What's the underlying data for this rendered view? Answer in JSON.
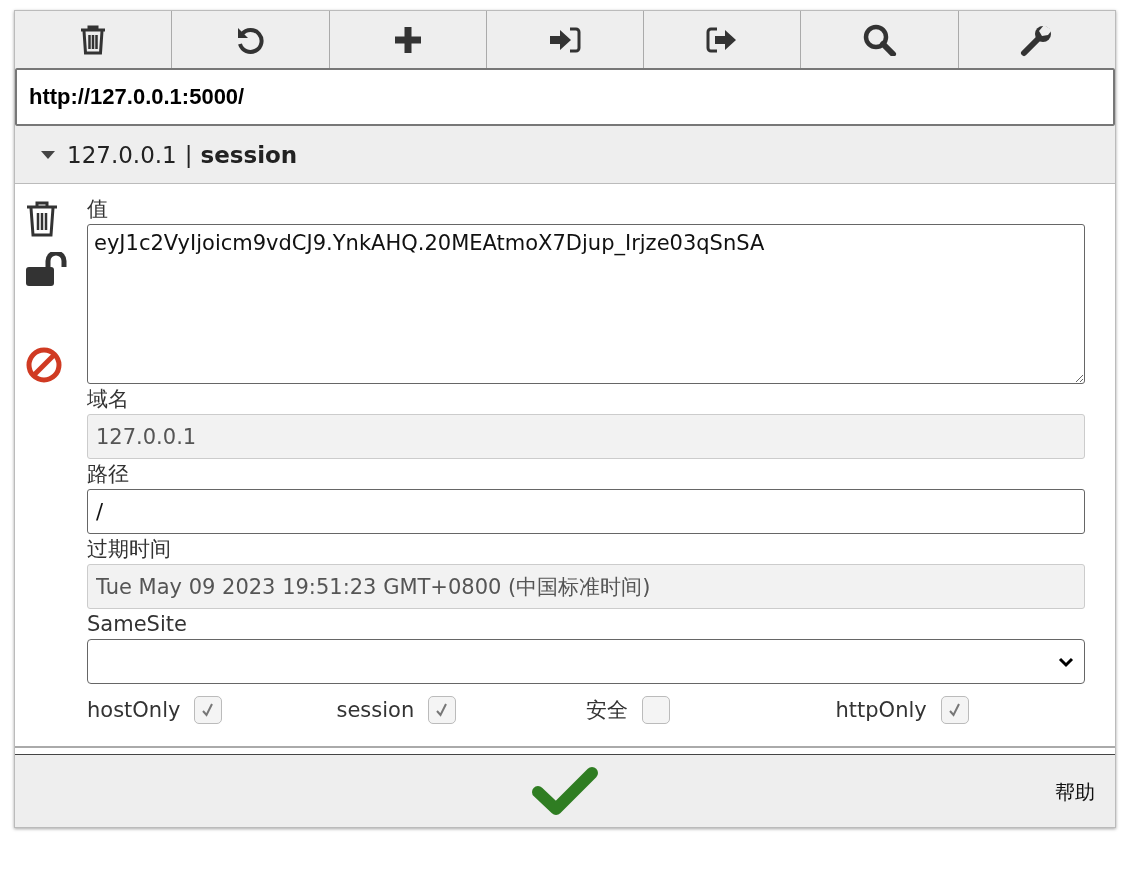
{
  "toolbar": {
    "buttons": [
      {
        "kind": "delete"
      },
      {
        "kind": "reset"
      },
      {
        "kind": "add"
      },
      {
        "kind": "import"
      },
      {
        "kind": "export"
      },
      {
        "kind": "search"
      },
      {
        "kind": "settings"
      }
    ]
  },
  "url": {
    "value": "http://127.0.0.1:5000/"
  },
  "cookie": {
    "expanded": true,
    "domain": "127.0.0.1",
    "separator": "|",
    "name": "session",
    "value": {
      "label": "值",
      "value": "eyJ1c2VyIjoicm9vdCJ9.YnkAHQ.20MEAtmoX7Djup_Irjze03qSnSA"
    },
    "fields": [
      {
        "label": "域名",
        "value": "127.0.0.1",
        "readonly": true
      },
      {
        "label": "路径",
        "value": "/",
        "readonly": false
      },
      {
        "label": "过期时间",
        "value": "Tue May 09 2023 19:51:23 GMT+0800 (中国标准时间)",
        "readonly": true
      }
    ],
    "samesite": {
      "label": "SameSite"
    },
    "flags": [
      {
        "label": "hostOnly",
        "checked": true
      },
      {
        "label": "session",
        "checked": true
      },
      {
        "label": "安全",
        "checked": false
      },
      {
        "label": "httpOnly",
        "checked": true
      }
    ]
  },
  "footer": {
    "help": "帮助"
  }
}
